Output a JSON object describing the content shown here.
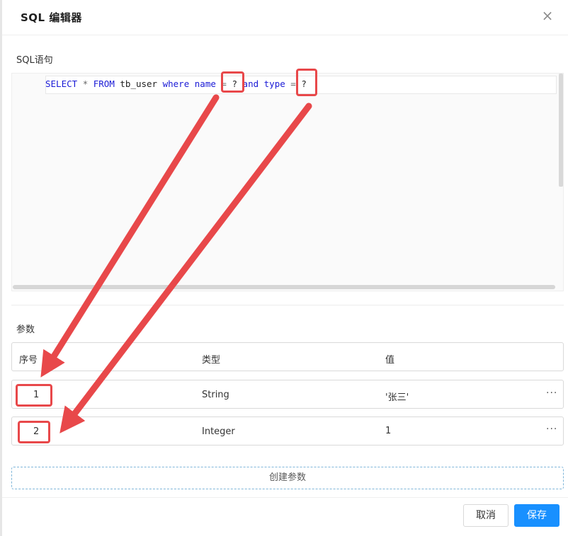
{
  "dialog": {
    "title": "SQL 编辑器",
    "close_glyph": "×"
  },
  "sql_section": {
    "label": "SQL语句",
    "tokens": {
      "select": "SELECT",
      "star": "*",
      "from": "FROM",
      "table": "tb_user",
      "where": "where",
      "col1": "name",
      "eq1": "=",
      "q1": "?",
      "and": "and",
      "col2": "type",
      "eq2": "=",
      "q2": "?"
    }
  },
  "params_section": {
    "label": "参数",
    "columns": [
      "序号",
      "类型",
      "值"
    ],
    "rows": [
      {
        "index": "1",
        "type": "String",
        "value": "'张三'",
        "more": "···"
      },
      {
        "index": "2",
        "type": "Integer",
        "value": "1",
        "more": "···"
      }
    ],
    "create_button": "创建参数"
  },
  "footer": {
    "cancel": "取消",
    "save": "保存"
  },
  "colors": {
    "annotation": "#e8484a",
    "primary": "#1890ff",
    "keyword": "#1a1ad6"
  },
  "icons": [
    "close-icon",
    "more-icon",
    "arrow-annotation"
  ]
}
